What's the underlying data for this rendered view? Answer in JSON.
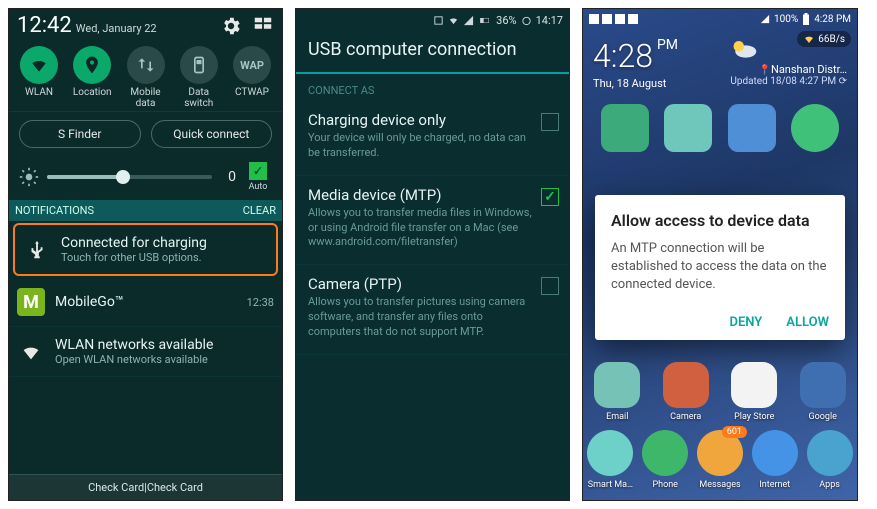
{
  "phone1": {
    "status": {
      "time": "12:42",
      "date": "Wed, January 22"
    },
    "quick_settings": [
      {
        "label": "WLAN",
        "on": true,
        "icon": "wifi-icon"
      },
      {
        "label": "Location",
        "on": true,
        "icon": "location-icon"
      },
      {
        "label": "Mobile data",
        "on": false,
        "icon": "mobile-data-icon"
      },
      {
        "label": "Data switch",
        "on": false,
        "icon": "sim-icon"
      },
      {
        "label": "CTWAP",
        "on": false,
        "text": "WAP"
      }
    ],
    "buttons": {
      "sfinder": "S Finder",
      "quickconnect": "Quick connect"
    },
    "brightness": {
      "value": "0",
      "auto": "Auto"
    },
    "notif_header": {
      "title": "NOTIFICATIONS",
      "clear": "Clear"
    },
    "notifications": [
      {
        "title": "Connected for charging",
        "sub": "Touch for other USB options.",
        "time": "",
        "highlight": true,
        "icon": "usb-icon"
      },
      {
        "title": "MobileGo™",
        "sub": "",
        "time": "12:38",
        "highlight": false,
        "icon": "mobilego-icon"
      },
      {
        "title": "WLAN networks available",
        "sub": "Open WLAN networks available",
        "time": "",
        "highlight": false,
        "icon": "wifi-open-icon"
      }
    ],
    "footer": "Check Card|Check Card"
  },
  "phone2": {
    "status": {
      "battery": "36%",
      "time": "14:17"
    },
    "title": "USB computer connection",
    "section": "CONNECT AS",
    "options": [
      {
        "title": "Charging device only",
        "desc": "Your device will only be charged, no data can be transferred.",
        "checked": false
      },
      {
        "title": "Media device (MTP)",
        "desc": "Allows you to transfer media files in Windows, or using Android file transfer on a Mac (see www.android.com/filetransfer)",
        "checked": true
      },
      {
        "title": "Camera (PTP)",
        "desc": "Allows you to transfer pictures using camera software, and transfer any files onto computers that do not support MTP.",
        "checked": false
      }
    ]
  },
  "phone3": {
    "status": {
      "battery": "100%",
      "time": "4:28 PM"
    },
    "speed": "66B/s",
    "clock": {
      "time": "4:28",
      "ampm": "PM",
      "date": "Thu, 18 August",
      "location": "Nanshan Distr…",
      "updated": "Updated 18/08 4:27 PM"
    },
    "dialog": {
      "title": "Allow access to device data",
      "body": "An MTP connection will be established to access the data on the connected device.",
      "deny": "DENY",
      "allow": "ALLOW"
    },
    "row1_apps": [
      {
        "label": "Email",
        "color": "#76c2b6"
      },
      {
        "label": "Camera",
        "color": "#d0603f"
      },
      {
        "label": "Play Store",
        "color": "#f3f3f3"
      },
      {
        "label": "Google",
        "color": "#3f6fb0"
      }
    ],
    "row2_apps": [
      {
        "label": "Smart Ma…",
        "color": "#6dd0c9"
      },
      {
        "label": "Phone",
        "color": "#3fb76a"
      },
      {
        "label": "Messages",
        "color": "#f0a63d",
        "badge": "601"
      },
      {
        "label": "Internet",
        "color": "#4593e6"
      },
      {
        "label": "Apps",
        "color": "#4aa3cf"
      }
    ]
  }
}
